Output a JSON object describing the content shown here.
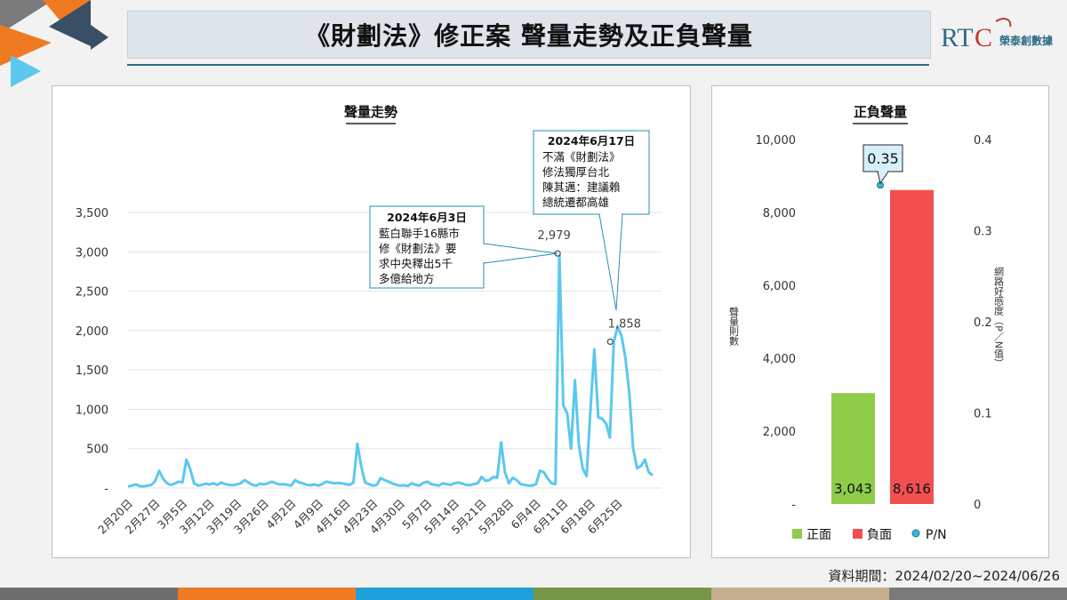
{
  "page_title": "《財劃法》修正案  聲量走勢及正負聲量",
  "logo": {
    "mark": "RTC",
    "name": "榮泰創數據"
  },
  "footer": {
    "period_label": "資料期間：2024/02/20~2024/06/26"
  },
  "colors": {
    "line": "#5bc8ef",
    "positive": "#8fcc4a",
    "negative": "#f25050",
    "pn": "#3bb7d9",
    "title_bg": "#dfe3ea",
    "accent": "#2f6b87",
    "bottom_bar": [
      "#6e6e6e",
      "#f07a22",
      "#1ea0da",
      "#78964a",
      "#c4ae8e",
      "#7a7a7a"
    ]
  },
  "chart_data": [
    {
      "type": "line",
      "title": "聲量走勢",
      "ylim": [
        0,
        3500
      ],
      "yticks": [
        0,
        500,
        1000,
        1500,
        2000,
        2500,
        3000,
        3500
      ],
      "ytick_labels": [
        "-",
        "500",
        "1,000",
        "1,500",
        "2,000",
        "2,500",
        "3,000",
        "3,500"
      ],
      "x_start": "2月20日",
      "x_end": "6月26日",
      "xtick_labels": [
        "2月20日",
        "2月27日",
        "3月5日",
        "3月12日",
        "3月19日",
        "3月26日",
        "4月2日",
        "4月9日",
        "4月16日",
        "4月23日",
        "4月30日",
        "5月7日",
        "5月14日",
        "5月21日",
        "5月28日",
        "6月4日",
        "6月11日",
        "6月18日",
        "6月25日"
      ],
      "series": [
        {
          "values": [
            20,
            30,
            45,
            25,
            20,
            30,
            40,
            90,
            220,
            120,
            60,
            40,
            55,
            80,
            70,
            360,
            240,
            60,
            30,
            40,
            55,
            45,
            60,
            40,
            70,
            50,
            40,
            35,
            45,
            60,
            100,
            70,
            40,
            30,
            55,
            45,
            60,
            80,
            60,
            45,
            50,
            40,
            30,
            100,
            70,
            60,
            40,
            35,
            45,
            30,
            50,
            80,
            70,
            60,
            65,
            60,
            50,
            40,
            70,
            560,
            280,
            70,
            50,
            30,
            40,
            125,
            100,
            80,
            60,
            40,
            30,
            35,
            25,
            60,
            40,
            30,
            65,
            80,
            50,
            40,
            30,
            60,
            50,
            40,
            60,
            70,
            55,
            40,
            35,
            50,
            60,
            140,
            90,
            100,
            140,
            130,
            580,
            200,
            60,
            130,
            100,
            50,
            40,
            30,
            30,
            50,
            220,
            200,
            120,
            60,
            50,
            2979,
            1050,
            950,
            500,
            1370,
            550,
            250,
            150,
            1000,
            1760,
            900,
            880,
            820,
            640,
            1858,
            2050,
            1930,
            1650,
            1200,
            500,
            250,
            280,
            360,
            200,
            160
          ]
        }
      ],
      "annotations": [
        {
          "value_label": "2,979",
          "title": "2024年6月3日",
          "lines": [
            "藍白聯手16縣市",
            "修《財劃法》要",
            "求中央釋出5千",
            "多億給地方"
          ]
        },
        {
          "value_label": "1,858",
          "title": "2024年6月17日",
          "lines": [
            "不滿《財劃法》",
            "修法獨厚台北",
            "陳其邁：建議賴",
            "總統遷都高雄"
          ]
        }
      ]
    },
    {
      "type": "bar",
      "title": "正負聲量",
      "categories": [
        "正面",
        "負面"
      ],
      "values": [
        3043,
        8616
      ],
      "value_labels": [
        "3,043",
        "8,616"
      ],
      "ylim": [
        0,
        10000
      ],
      "yticks": [
        0,
        2000,
        4000,
        6000,
        8000,
        10000
      ],
      "ytick_labels": [
        "-",
        "2,000",
        "4,000",
        "6,000",
        "8,000",
        "10,000"
      ],
      "ylabel": "聲量則數",
      "y2lim": [
        0,
        0.4
      ],
      "y2ticks": [
        0,
        0.1,
        0.2,
        0.3,
        0.4
      ],
      "y2tick_labels": [
        "0",
        "0.1",
        "0.2",
        "0.3",
        "0.4"
      ],
      "y2label": "網路好感度（P／N值）",
      "pn_value": 0.35,
      "pn_label": "0.35",
      "legend": [
        "正面",
        "負面",
        "P/N"
      ],
      "legend_position": "bottom"
    }
  ]
}
